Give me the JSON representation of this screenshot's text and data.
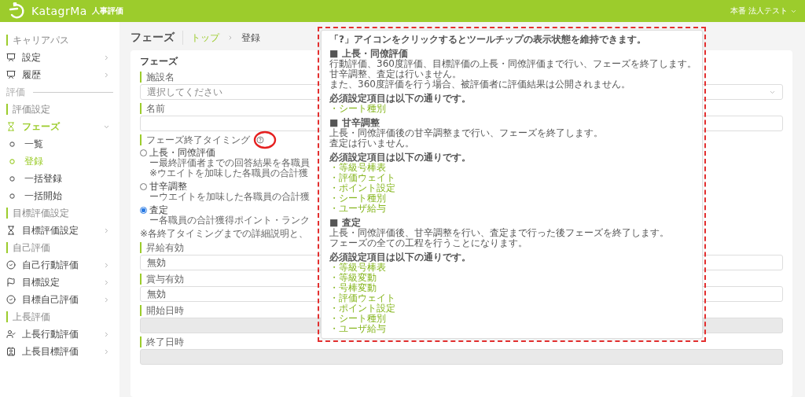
{
  "header": {
    "logo_text": "KatagrMa",
    "product": "人事評価",
    "user": "本番 法人テスト"
  },
  "sidebar": [
    {
      "kind": "section",
      "label": "キャリアパス"
    },
    {
      "kind": "item",
      "label": "設定",
      "selected": false,
      "expanded": false
    },
    {
      "kind": "item",
      "label": "履歴",
      "selected": false,
      "expanded": false
    },
    {
      "kind": "divider",
      "label": "評価"
    },
    {
      "kind": "section",
      "label": "評価設定"
    },
    {
      "kind": "item",
      "label": "フェーズ",
      "selected": true,
      "expanded": true
    },
    {
      "kind": "subitem",
      "label": "一覧",
      "selected": false
    },
    {
      "kind": "subitem",
      "label": "登録",
      "selected": true
    },
    {
      "kind": "subitem",
      "label": "一括登録",
      "selected": false
    },
    {
      "kind": "subitem",
      "label": "一括開始",
      "selected": false
    },
    {
      "kind": "section",
      "label": "目標評価設定"
    },
    {
      "kind": "item",
      "label": "目標評価設定",
      "selected": false,
      "expanded": false
    },
    {
      "kind": "section",
      "label": "自己評価"
    },
    {
      "kind": "item",
      "label": "自己行動評価",
      "selected": false,
      "expanded": false
    },
    {
      "kind": "item",
      "label": "目標設定",
      "selected": false,
      "expanded": false
    },
    {
      "kind": "item",
      "label": "目標自己評価",
      "selected": false,
      "expanded": false
    },
    {
      "kind": "section",
      "label": "上長評価"
    },
    {
      "kind": "item",
      "label": "上長行動評価",
      "selected": false,
      "expanded": false
    },
    {
      "kind": "item",
      "label": "上長目標評価",
      "selected": false,
      "expanded": false
    }
  ],
  "page": {
    "title": "フェーズ",
    "breadcrumb": [
      {
        "label": "トップ",
        "link": true
      },
      {
        "label": "登録",
        "link": false
      }
    ]
  },
  "form": {
    "title": "フェーズ",
    "fields": [
      {
        "kind": "select",
        "label": "施設名",
        "placeholder": "選択してください",
        "disabled": false
      },
      {
        "kind": "text",
        "label": "名前",
        "disabled": false
      },
      {
        "kind": "radio",
        "label": "フェーズ終了タイミング",
        "options": [
          {
            "label": "上長・同僚評価",
            "selected": false,
            "lines": [
              "ー最終評価者までの回答結果を各職員",
              "※ウエイトを加味した各職員の合計獲"
            ]
          },
          {
            "label": "甘辛調整",
            "selected": false,
            "lines": [
              "ーウエイトを加味した各職員の合計獲"
            ]
          },
          {
            "label": "査定",
            "selected": true,
            "lines": [
              "ー各職員の合計獲得ポイント・ランク"
            ]
          }
        ],
        "note": "※各終了タイミングまでの詳細説明と、"
      },
      {
        "kind": "text",
        "label": "昇給有効",
        "value": "無効",
        "disabled": false
      },
      {
        "kind": "text",
        "label": "賞与有効",
        "value": "無効",
        "disabled": false
      },
      {
        "kind": "text",
        "label": "開始日時",
        "disabled": true
      },
      {
        "kind": "text",
        "label": "終了日時",
        "disabled": true
      }
    ]
  },
  "tooltip": {
    "intro": "「?」アイコンをクリックするとツールチップの表示状態を維持できます。",
    "sections": [
      {
        "heading": "■ 上長・同僚評価",
        "body": [
          "行動評価、360度評価、目標評価の上長・同僚評価まで行い、フェーズを終了します。",
          "甘辛調整、査定は行いません。",
          "また、360度評価を行う場合、被評価者に評価結果は公開されません。"
        ],
        "required_title": "必須設定項目は以下の通りです。",
        "required": [
          "・シート種別"
        ]
      },
      {
        "heading": "■ 甘辛調整",
        "body": [
          "上長・同僚評価後の甘辛調整まで行い、フェーズを終了します。",
          "査定は行いません。"
        ],
        "required_title": "必須設定項目は以下の通りです。",
        "required": [
          "・等級号棒表",
          "・評価ウェイト",
          "・ポイント設定",
          "・シート種別",
          "・ユーザ給与"
        ]
      },
      {
        "heading": "■ 査定",
        "body": [
          "上長・同僚評価後、甘辛調整を行い、査定まで行った後フェーズを終了します。",
          "フェーズの全ての工程を行うことになります。"
        ],
        "required_title": "必須設定項目は以下の通りです。",
        "required": [
          "・等級号棒表",
          "・等級変動",
          "・号棒変動",
          "・評価ウェイト",
          "・ポイント設定",
          "・シート種別",
          "・ユーザ給与"
        ]
      }
    ]
  }
}
